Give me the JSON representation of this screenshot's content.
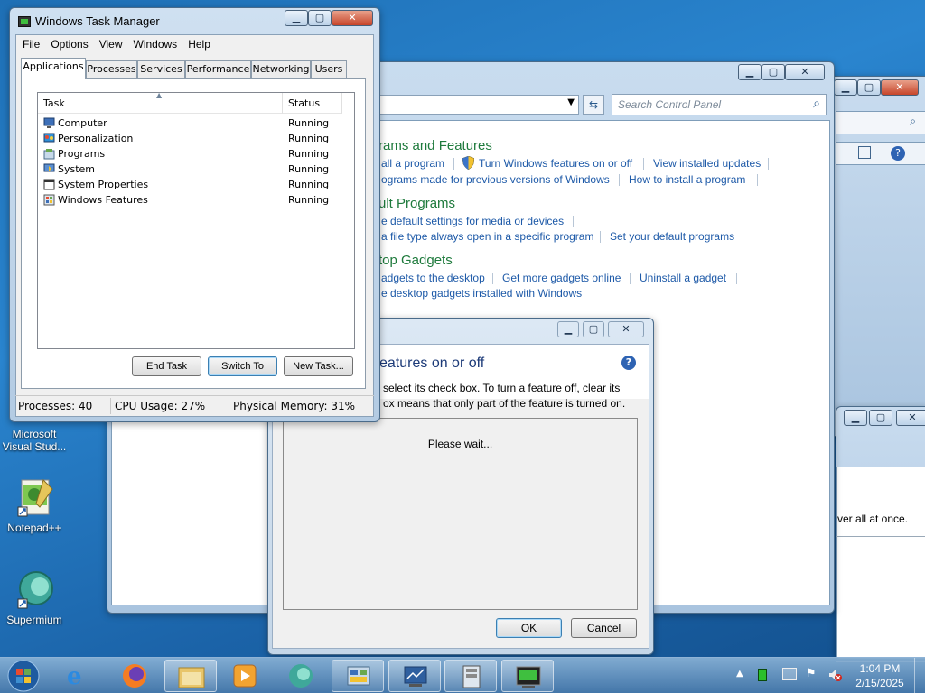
{
  "desktop": {
    "icons": [
      {
        "label": "Microsoft Visual Stud...",
        "icon": "visual-studio-icon"
      },
      {
        "label": "Notepad++",
        "icon": "notepad-plus-plus-icon"
      },
      {
        "label": "Supermium",
        "icon": "supermium-icon"
      }
    ]
  },
  "control_panel": {
    "search_placeholder": "Search Control Panel",
    "sections": [
      {
        "heading": "rams and Features",
        "row1": [
          "all a program",
          "Turn Windows features on or off",
          "View installed updates"
        ],
        "row2": [
          "ograms made for previous versions of Windows",
          "How to install a program"
        ]
      },
      {
        "heading": "ult Programs",
        "row1": [
          "e default settings for media or devices"
        ],
        "row2": [
          "a file type always open in a specific program",
          "Set your default programs"
        ]
      },
      {
        "heading": "top Gadgets",
        "row1": [
          "adgets to the desktop",
          "Get more gadgets online",
          "Uninstall a gadget"
        ],
        "row2": [
          "e desktop gadgets installed with Windows"
        ]
      }
    ]
  },
  "background_window": {
    "partial_text": "ver all at once."
  },
  "features_dialog": {
    "title": "eatures on or off",
    "description_line1": "select its check box. To turn a feature off, clear its",
    "description_line2": "ox means that only part of the feature is turned on.",
    "status": "Please wait...",
    "ok_label": "OK",
    "cancel_label": "Cancel"
  },
  "task_manager": {
    "title": "Windows Task Manager",
    "menu": [
      "File",
      "Options",
      "View",
      "Windows",
      "Help"
    ],
    "tabs": [
      "Applications",
      "Processes",
      "Services",
      "Performance",
      "Networking",
      "Users"
    ],
    "active_tab": "Applications",
    "columns": {
      "task": "Task",
      "status": "Status"
    },
    "rows": [
      {
        "task": "Computer",
        "status": "Running",
        "icon": "computer-icon"
      },
      {
        "task": "Personalization",
        "status": "Running",
        "icon": "personalization-icon"
      },
      {
        "task": "Programs",
        "status": "Running",
        "icon": "programs-icon"
      },
      {
        "task": "System",
        "status": "Running",
        "icon": "system-icon"
      },
      {
        "task": "System Properties",
        "status": "Running",
        "icon": "system-properties-icon"
      },
      {
        "task": "Windows Features",
        "status": "Running",
        "icon": "windows-features-icon"
      }
    ],
    "buttons": {
      "end_task": "End Task",
      "switch_to": "Switch To",
      "new_task": "New Task..."
    },
    "status_bar": {
      "processes": "Processes: 40",
      "cpu": "CPU Usage: 27%",
      "memory": "Physical Memory: 31%"
    }
  },
  "taskbar": {
    "pinned": [
      "windows-explorer-icon",
      "internet-explorer-icon",
      "firefox-icon",
      "media-player-icon",
      "supermium-icon",
      "control-panel-icon",
      "task-manager-icon",
      "system-properties-icon",
      "command-prompt-icon"
    ],
    "clock_time": "1:04 PM",
    "clock_date": "2/15/2025"
  },
  "colors": {
    "link": "#1e5aa8",
    "heading": "#1e7a3c",
    "desktop": "#2a85cf"
  }
}
